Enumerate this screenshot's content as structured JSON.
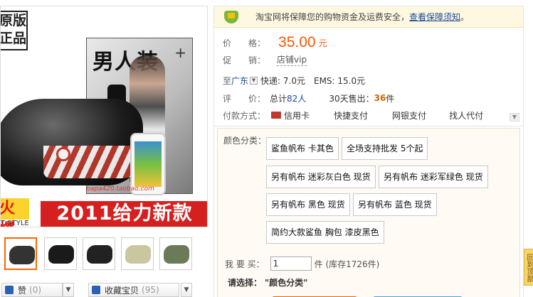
{
  "product": {
    "stamp": [
      "原版",
      "正品"
    ],
    "magazine_title": "男人装",
    "watermark": "papa420.taobao.com",
    "banner_burst": "火爆",
    "banner_headline": "2011给力新款",
    "banner_sub": "T STYLE"
  },
  "thumbnails": [
    {
      "name": "thumb-1",
      "color": "#333333"
    },
    {
      "name": "thumb-2",
      "color": "#1a1a1a"
    },
    {
      "name": "thumb-3",
      "color": "#222222"
    },
    {
      "name": "thumb-4",
      "color": "#c9c7a0"
    },
    {
      "name": "thumb-5",
      "color": "#6b7a58"
    }
  ],
  "actions": {
    "like_label": "赞",
    "like_count": "(0)",
    "favorite_label": "收藏宝贝",
    "favorite_count": "(95)"
  },
  "notice": {
    "text": "淘宝网将保障您的购物资金及运费安全，",
    "link": "查看保障须知",
    "tail": "。"
  },
  "price": {
    "label": "价　　格：",
    "value": "35.00",
    "unit": "元"
  },
  "promo": {
    "label": "促　　销：",
    "value": "店铺vip"
  },
  "shipping": {
    "to_label": "至",
    "destination": "广东",
    "express": "快递: 7.0元",
    "ems": "EMS: 15.0元"
  },
  "rating": {
    "label": "评　　价：",
    "total_prefix": "总计",
    "total_link": "82人",
    "sold_prefix": "30天售出：",
    "sold_count": "36",
    "sold_suffix": "件"
  },
  "payment": {
    "label": "付款方式：",
    "options": [
      "信用卡",
      "快捷支付",
      "网银支付",
      "找人代付"
    ]
  },
  "sku": {
    "label": "颜色分类：",
    "options": [
      "鲨鱼帆布 卡其色",
      "全场支持批发 5个起",
      "另有帆布 迷彩灰白色 现货",
      "另有帆布 迷彩军绿色 现货",
      "另有帆布 黑色 现货",
      "另有帆布 蓝色 现货",
      "简约大款鲨鱼 胸包 漆皮黑色"
    ]
  },
  "quantity": {
    "label": "我 要 买：",
    "value": "1",
    "stock": "件 (库存1726件)"
  },
  "select_prompt": {
    "label": "请选择：",
    "value": "\"颜色分类\""
  },
  "side_tab": "回到顶部",
  "colors": {
    "price_accent": "#ff5500",
    "link": "#1a4a9b",
    "buy_button": "#ff7e1e",
    "cart_button": "#6ec2ec",
    "banner_red": "#d61f1f"
  }
}
